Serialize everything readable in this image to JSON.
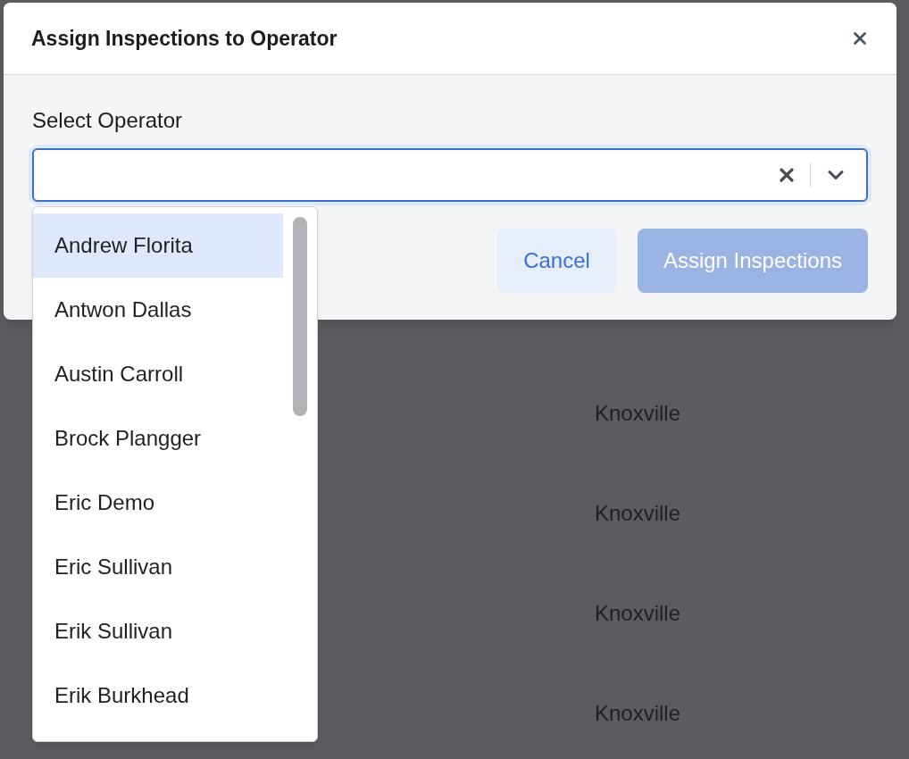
{
  "background_table": {
    "rows": [
      {
        "city": "Knoxville"
      },
      {
        "city": "Knoxville"
      },
      {
        "city": "Knoxville"
      },
      {
        "city": "Knoxville"
      }
    ]
  },
  "dialog": {
    "title": "Assign Inspections to Operator",
    "field": {
      "label": "Select Operator",
      "expanded": true,
      "options": [
        {
          "label": "Andrew Florita",
          "selected": true
        },
        {
          "label": "Antwon Dallas",
          "selected": false
        },
        {
          "label": "Austin Carroll",
          "selected": false
        },
        {
          "label": "Brock Plangger",
          "selected": false
        },
        {
          "label": "Eric Demo",
          "selected": false
        },
        {
          "label": "Eric Sullivan",
          "selected": false
        },
        {
          "label": "Erik Sullivan",
          "selected": false
        },
        {
          "label": "Erik Burkhead",
          "selected": false
        }
      ]
    },
    "buttons": [
      {
        "label": "Cancel",
        "kind": "secondary",
        "disabled": false
      },
      {
        "label": "Assign Inspections",
        "kind": "primary",
        "disabled": true
      }
    ]
  }
}
